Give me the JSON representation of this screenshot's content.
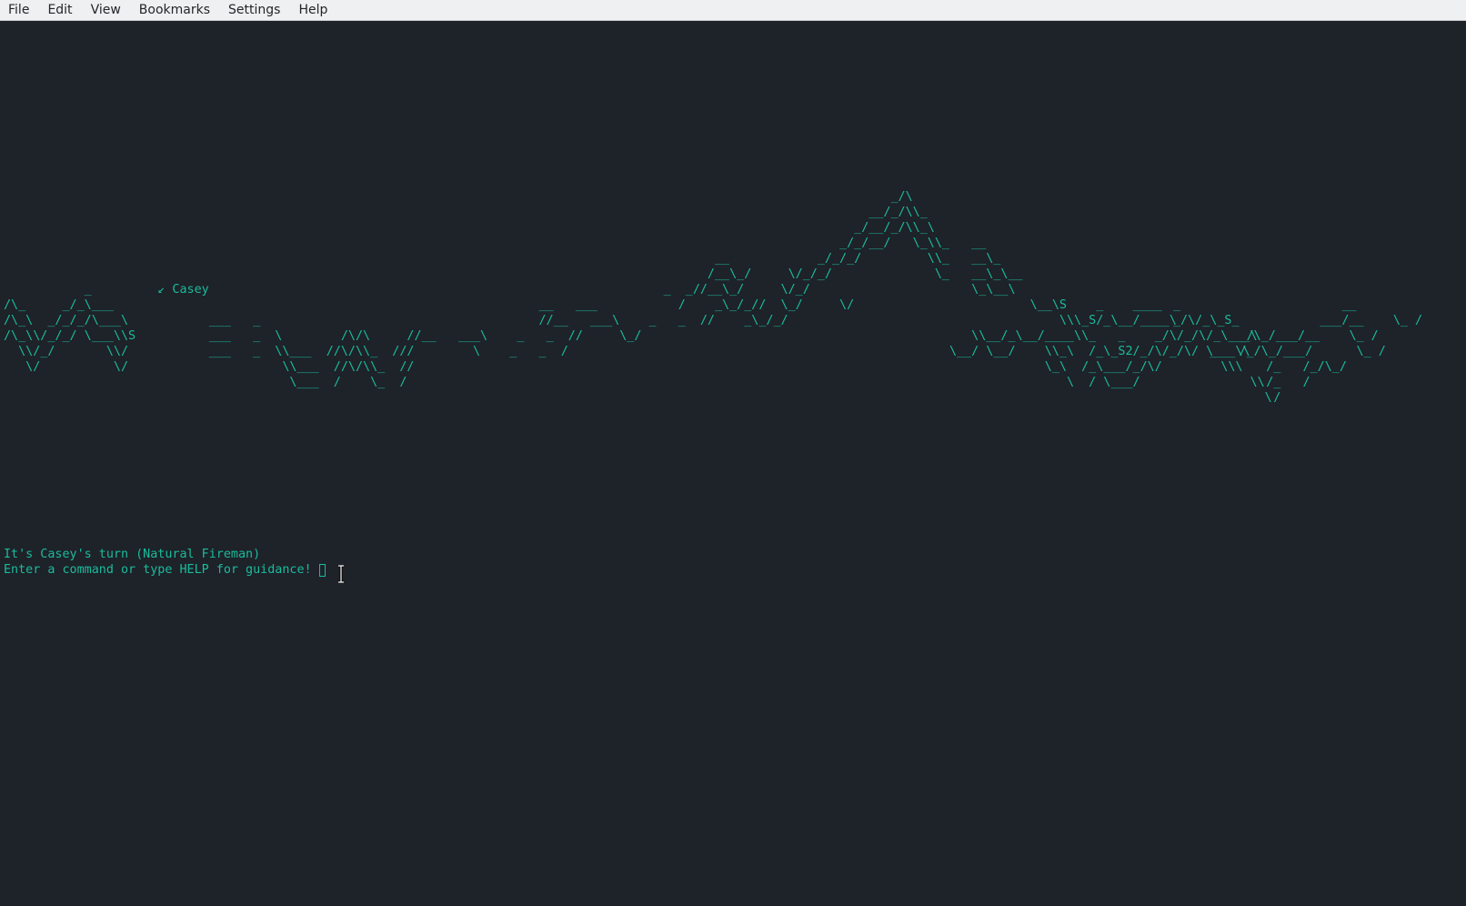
{
  "menu": {
    "file": "File",
    "edit": "Edit",
    "view": "View",
    "bookmarks": "Bookmarks",
    "settings": "Settings",
    "help": "Help"
  },
  "terminal": {
    "art_lines": [
      "                                                                                                                         _/\\",
      "                                                                                                                      __/_/\\\\_",
      "                                                                                                                    _/__/_/\\\\_\\",
      "                                                                                                                  _/_/__/   \\_\\\\_   __",
      "                                                                                                 __            _/_/_/         \\\\_   __\\_",
      "                                                                                                /__\\_/     \\/_/_/              \\_   __\\_\\__",
      "           _         ↙ Casey                                                              _  _//__\\_/     \\/_/                      \\_\\__\\",
      "/\\_     _/_\\___                                                          __   ___           /    _\\_/_//  \\_/     \\/                        \\__\\S    _    ____",
      "/\\_\\  _/_/_/\\___\\           ___   _                                      //__   ___\\    _   _  //    _\\_/_/                                     \\\\\\_S/_\\__/____\\",
      "/\\_\\\\/_/_/ \\___\\\\S          ___   _  \\        /\\/\\     //__   ___\\    _   _  //     \\_/                                             \\\\__/_\\__/____\\\\_   _    _/\\/_/\\/_\\___\\",
      "  \\\\/_/       \\\\/           ___   _  \\\\___  //\\/\\\\_  ///        \\    _   _  /                                                    \\__/ \\__/    \\\\_\\  /_\\_S2/_/\\/_/\\/ \\___\\\\",
      "   \\/          \\/                     \\\\___  //\\/\\\\_  //                                                                                      \\_\\  /_\\___/_/\\/        \\\\\\",
      "                                       \\___  /    \\_  /                                                                                          \\  / \\___/               \\\\",
      "                                                                                                                                                                            \\"
    ],
    "art_lines_right": [
      "",
      "",
      "",
      "",
      "",
      "",
      "",
      "_                      __",
      "_/\\/_\\_S_           ___/__    \\_ /",
      "         _/\\_/___/__    \\_ /",
      "     _   /_/\\_/___/      \\_ /",
      "    /_   /_/\\_/",
      "    /_   /",
      "     /"
    ],
    "status_line": "It's Casey's turn (Natural Fireman)",
    "prompt_line": "Enter a command or type HELP for guidance!"
  }
}
